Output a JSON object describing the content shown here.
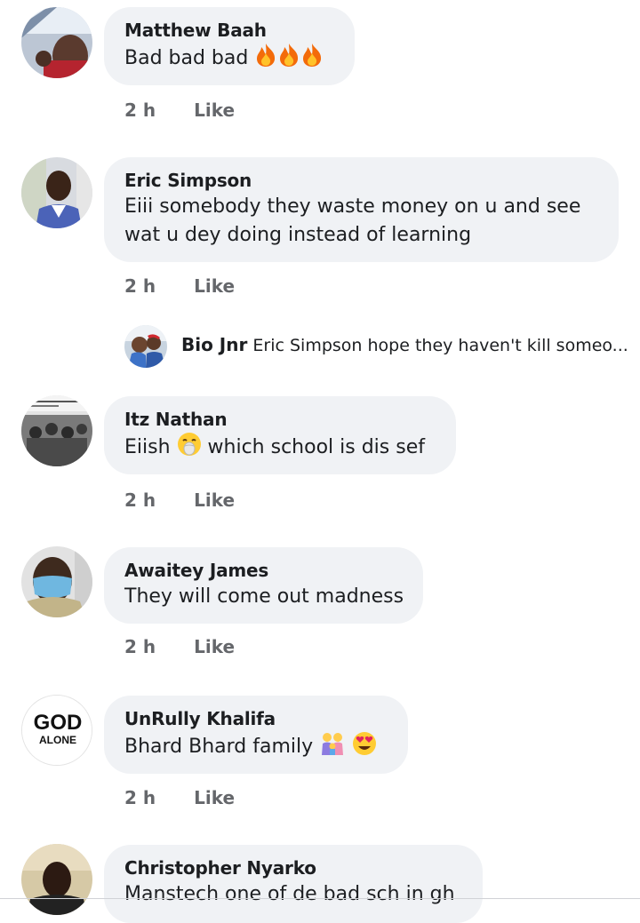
{
  "comments": [
    {
      "name": "Matthew Baah",
      "text": "Bad bad bad",
      "emoji": [
        "fire",
        "fire",
        "fire"
      ],
      "time": "2 h",
      "like": "Like"
    },
    {
      "name": "Eric Simpson",
      "text_line1": "Eiii somebody they waste money on u and see",
      "text_line2": "wat u dey doing instead of learning",
      "time": "2 h",
      "like": "Like"
    },
    {
      "name": "Itz Nathan",
      "text_before": "Eiish",
      "text_after": "which school is dis sef",
      "emoji": [
        "face-with-open-mouth-vomiting"
      ],
      "time": "2 h",
      "like": "Like"
    },
    {
      "name": "Awaitey James",
      "text": "They will come out madness",
      "time": "2 h",
      "like": "Like"
    },
    {
      "name": "UnRully Khalifa",
      "text": "Bhard Bhard family",
      "emoji": [
        "family",
        "heart-eyes"
      ],
      "avatar_text_top": "GOD",
      "avatar_text_bottom": "ALONE",
      "time": "2 h",
      "like": "Like"
    },
    {
      "name": "Christopher Nyarko",
      "text": "Manstech one of de bad sch in gh"
    }
  ],
  "reply": {
    "name": "Bio Jnr",
    "text": "Eric Simpson hope they haven't kill someo..."
  },
  "colors": {
    "bubble": "#f0f2f5",
    "meta": "#65676b",
    "text": "#1c1e21"
  }
}
